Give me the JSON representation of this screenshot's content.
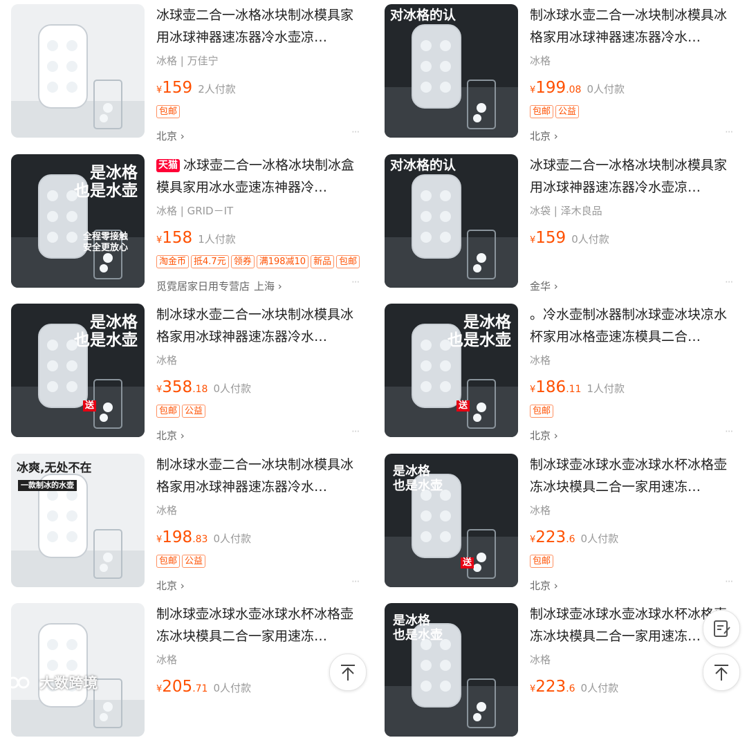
{
  "products": [
    {
      "title": "冰球壶二合一冰格冰块制冰模具家用冰球神器速冻器冷水壶凉…",
      "tmall": "",
      "attr": "冰格 | 万佳宁",
      "currency": "¥",
      "price_int": "159",
      "price_dec": "",
      "sold": "2人付款",
      "tags": [
        "包邮"
      ],
      "shop": "",
      "location": "北京 ›",
      "more": "···",
      "thumb_overlay": ""
    },
    {
      "title": "制冰球水壶二合一冰块制冰模具冰格家用冰球神器速冻器冷水…",
      "tmall": "",
      "attr": "冰格",
      "currency": "¥",
      "price_int": "199",
      "price_dec": ".08",
      "sold": "0人付款",
      "tags": [
        "包邮",
        "公益"
      ],
      "shop": "",
      "location": "北京 ›",
      "more": "···",
      "thumb_overlay": "对冰格的认"
    },
    {
      "title": "冰球壶二合一冰格冰块制冰盒模具家用冰水壶速冻神器冷…",
      "tmall": "天猫",
      "attr": "冰格 | GRID－IT",
      "currency": "¥",
      "price_int": "158",
      "price_dec": "",
      "sold": "1人付款",
      "tags": [
        "淘金币",
        "抵4.7元",
        "领券",
        "满198减10",
        "新品",
        "包邮"
      ],
      "shop": "觅霓居家日用专营店",
      "location": "上海 ›",
      "more": "···",
      "thumb_overlay": "是冰格\n也是水壶",
      "thumb_overlay2": "全程零接触\n安全更放心"
    },
    {
      "title": "冰球壶二合一冰格冰块制冰模具家用冰球神器速冻器冷水壶凉…",
      "tmall": "",
      "attr": "冰袋 | 泽木良品",
      "currency": "¥",
      "price_int": "159",
      "price_dec": "",
      "sold": "0人付款",
      "tags": [],
      "shop": "",
      "location": "金华 ›",
      "more": "···",
      "thumb_overlay": "对冰格的认"
    },
    {
      "title": "制冰球水壶二合一冰块制冰模具冰格家用冰球神器速冻器冷水…",
      "tmall": "",
      "attr": "冰格",
      "currency": "¥",
      "price_int": "358",
      "price_dec": ".18",
      "sold": "0人付款",
      "tags": [
        "包邮",
        "公益"
      ],
      "shop": "",
      "location": "北京 ›",
      "more": "···",
      "thumb_overlay": "是冰格\n也是水壶",
      "thumb_overlay2": "送"
    },
    {
      "title": "。冷水壶制冰器制冰球壶冰块凉水杯家用冰格壶速冻模具二合…",
      "tmall": "",
      "attr": "冰格",
      "currency": "¥",
      "price_int": "186",
      "price_dec": ".11",
      "sold": "1人付款",
      "tags": [
        "包邮"
      ],
      "shop": "",
      "location": "北京 ›",
      "more": "···",
      "thumb_overlay": "是冰格\n也是水壶",
      "thumb_overlay2": "送"
    },
    {
      "title": "制冰球水壶二合一冰块制冰模具冰格家用冰球神器速冻器冷水…",
      "tmall": "",
      "attr": "冰格",
      "currency": "¥",
      "price_int": "198",
      "price_dec": ".83",
      "sold": "0人付款",
      "tags": [
        "包邮",
        "公益"
      ],
      "shop": "",
      "location": "北京 ›",
      "more": "···",
      "thumb_overlay": "冰爽,无处不在",
      "thumb_overlay2": "一款制冰的水壶"
    },
    {
      "title": "制冰球壶冰球水壶冰球水杯冰格壶冻冰块模具二合一家用速冻…",
      "tmall": "",
      "attr": "冰格",
      "currency": "¥",
      "price_int": "223",
      "price_dec": ".6",
      "sold": "0人付款",
      "tags": [
        "包邮"
      ],
      "shop": "",
      "location": "北京 ›",
      "more": "···",
      "thumb_overlay": "是冰格\n也是水壶",
      "thumb_overlay2": "送"
    },
    {
      "title": "制冰球壶冰球水壶冰球水杯冰格壶冻冰块模具二合一家用速冻…",
      "tmall": "",
      "attr": "冰格",
      "currency": "¥",
      "price_int": "205",
      "price_dec": ".71",
      "sold": "0人付款",
      "tags": [],
      "shop": "",
      "location": "",
      "more": "",
      "thumb_overlay": ""
    },
    {
      "title": "制冰球壶冰球水壶冰球水杯冰格壶冻冰块模具二合一家用速冻…",
      "tmall": "",
      "attr": "冰格",
      "currency": "¥",
      "price_int": "223",
      "price_dec": ".6",
      "sold": "0人付款",
      "tags": [],
      "shop": "",
      "location": "",
      "more": "",
      "thumb_overlay": "是冰格\n也是水壶"
    }
  ],
  "floating": {
    "note_icon": "edit-note-icon",
    "top_icon": "back-to-top-icon"
  },
  "watermark": {
    "text": "大数跨境"
  },
  "colors": {
    "accent": "#ff5000",
    "tmall": "#ff0036",
    "muted": "#999999"
  }
}
